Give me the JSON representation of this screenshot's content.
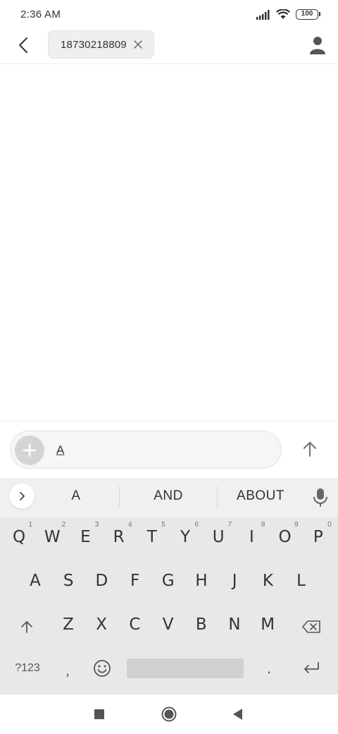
{
  "status_bar": {
    "time": "2:36 AM",
    "battery": "100"
  },
  "header": {
    "recipient": "18730218809"
  },
  "compose": {
    "text": "A"
  },
  "keyboard": {
    "suggestions": [
      "A",
      "AND",
      "ABOUT"
    ],
    "row1": [
      {
        "label": "Q",
        "hint": "1"
      },
      {
        "label": "W",
        "hint": "2"
      },
      {
        "label": "E",
        "hint": "3"
      },
      {
        "label": "R",
        "hint": "4"
      },
      {
        "label": "T",
        "hint": "5"
      },
      {
        "label": "Y",
        "hint": "6"
      },
      {
        "label": "U",
        "hint": "7"
      },
      {
        "label": "I",
        "hint": "8"
      },
      {
        "label": "O",
        "hint": "9"
      },
      {
        "label": "P",
        "hint": "0"
      }
    ],
    "row2": [
      "A",
      "S",
      "D",
      "F",
      "G",
      "H",
      "J",
      "K",
      "L"
    ],
    "row3": [
      "Z",
      "X",
      "C",
      "V",
      "B",
      "N",
      "M"
    ],
    "symbols_label": "?123",
    "comma_label": ",",
    "period_label": "."
  },
  "colors": {
    "keyboard_bg": "#e8e8e8",
    "suggestion_bg": "#f0f0f0",
    "text": "#333333"
  },
  "icons": [
    "back-arrow-icon",
    "close-icon",
    "contact-icon",
    "plus-icon",
    "send-arrow-icon",
    "chevron-right-icon",
    "microphone-icon",
    "shift-icon",
    "backspace-icon",
    "emoji-icon",
    "enter-icon",
    "square-icon",
    "circle-icon",
    "triangle-back-icon"
  ]
}
